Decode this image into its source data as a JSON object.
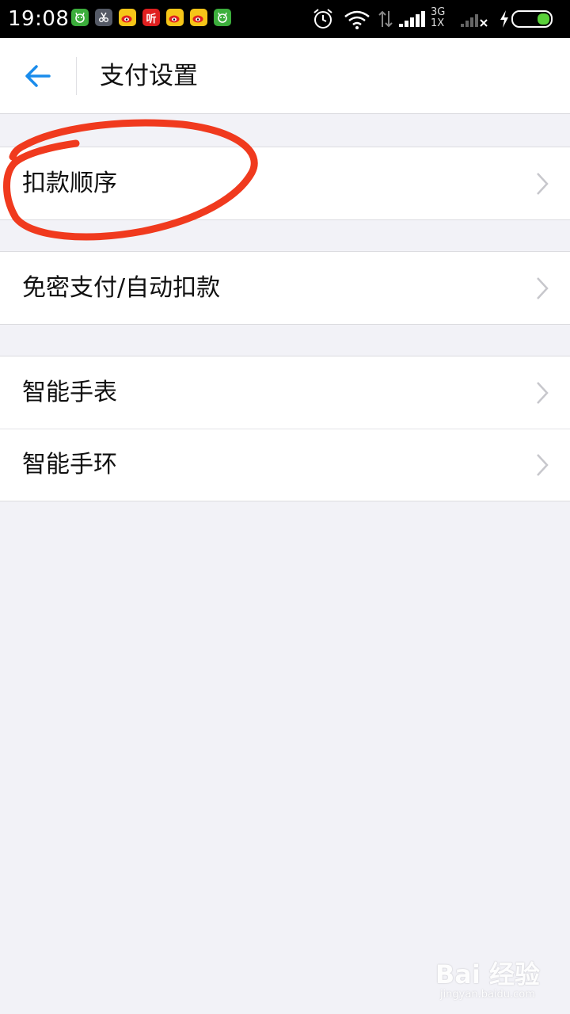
{
  "status_bar": {
    "time": "19:08",
    "network_type_top": "3G",
    "network_type_bottom": "1X",
    "notification_icons": [
      "app-icon",
      "scissors-icon",
      "weibo-icon",
      "ting-icon",
      "weibo-icon",
      "weibo-icon",
      "app-icon"
    ],
    "notification_ting_label": "听"
  },
  "header": {
    "title": "支付设置",
    "accent_color": "#1a8cec"
  },
  "groups": [
    {
      "items": [
        {
          "label": "扣款顺序"
        }
      ]
    },
    {
      "items": [
        {
          "label": "免密支付/自动扣款"
        }
      ]
    },
    {
      "items": [
        {
          "label": "智能手表"
        },
        {
          "label": "智能手环"
        }
      ]
    }
  ],
  "annotation": {
    "color": "#f03a1e",
    "target": "扣款顺序"
  },
  "watermark": {
    "main": "Bai 经验",
    "sub": "jingyan.baidu.com"
  }
}
